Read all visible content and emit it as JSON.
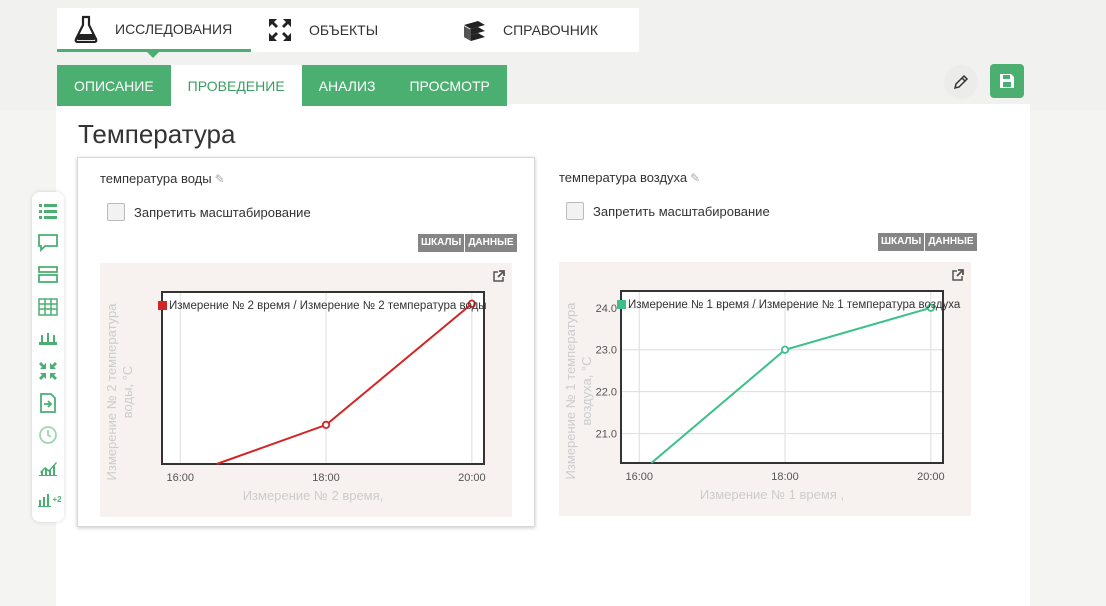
{
  "main_tabs": [
    {
      "label": "ИССЛЕДОВАНИЯ",
      "icon": "flask-icon",
      "active": true
    },
    {
      "label": "ОБЪЕКТЫ",
      "icon": "expand-arrows-icon",
      "active": false
    },
    {
      "label": "СПРАВОЧНИК",
      "icon": "books-icon",
      "active": false
    }
  ],
  "sub_tabs": [
    {
      "label": "ОПИСАНИЕ",
      "active": false
    },
    {
      "label": "ПРОВЕДЕНИЕ",
      "active": true
    },
    {
      "label": "АНАЛИЗ",
      "active": false
    },
    {
      "label": "ПРОСМОТР",
      "active": false
    }
  ],
  "page_title": "Температура",
  "sidebar_icons": [
    "list-icon",
    "comment-icon",
    "table-rows-icon",
    "grid-table-icon",
    "sensor-icon",
    "collapse-icon",
    "import-icon",
    "clock-icon",
    "chart-line-icon",
    "chart-multi-icon"
  ],
  "sidebar_badge": "+2",
  "colors": {
    "accent": "#4caf72",
    "water_series": "#d42424",
    "air_series": "#3cc088"
  },
  "chart_data": [
    {
      "type": "line",
      "title": "температура воды",
      "checkbox_label": "Запретить масштабирование",
      "buttons": [
        "ШКАЛЫ",
        "ДАННЫЕ"
      ],
      "xlabel": "Измерение № 2 время,",
      "ylabel": "Измерение № 2 температура воды, °C",
      "x_ticks": [
        "16:00",
        "18:00",
        "20:00"
      ],
      "y_ticks": [],
      "series": [
        {
          "name": "Измерение № 2 время / Измерение № 2 температура воды",
          "x": [
            "16:30",
            "18:00",
            "20:00"
          ],
          "y": [
            19.7,
            20.7,
            23.8
          ]
        }
      ],
      "xlim": [
        "15:45",
        "20:10"
      ],
      "ylim": [
        19.7,
        24.1
      ],
      "grid": true,
      "legend": "top-left"
    },
    {
      "type": "line",
      "title": "температура воздуха",
      "checkbox_label": "Запретить масштабирование",
      "buttons": [
        "ШКАЛЫ",
        "ДАННЫЕ"
      ],
      "xlabel": "Измерение № 1 время ,",
      "ylabel": "Измерение № 1 температура воздуха, °C",
      "x_ticks": [
        "16:00",
        "18:00",
        "20:00"
      ],
      "y_ticks": [
        "21.0",
        "22.0",
        "23.0",
        "24.0"
      ],
      "series": [
        {
          "name": "Измерение № 1 время / Измерение № 1 температура воздуха",
          "x": [
            "16:10",
            "18:00",
            "20:00"
          ],
          "y": [
            20.3,
            23.0,
            24.0
          ]
        }
      ],
      "xlim": [
        "15:45",
        "20:10"
      ],
      "ylim": [
        20.3,
        24.4
      ],
      "grid": true,
      "legend": "top-left"
    }
  ]
}
